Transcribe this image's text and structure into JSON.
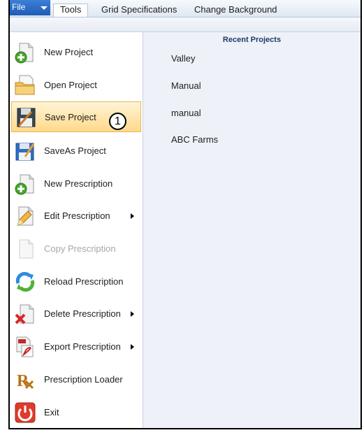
{
  "menubar": {
    "file_label": "File",
    "tabs": [
      {
        "label": "Tools",
        "active": true
      },
      {
        "label": "Grid Specifications",
        "active": false
      },
      {
        "label": "Change Background",
        "active": false
      }
    ]
  },
  "menu": {
    "items": [
      {
        "label": "New Project",
        "icon": "new-project-icon"
      },
      {
        "label": "Open Project",
        "icon": "open-folder-icon"
      },
      {
        "label": "Save Project",
        "icon": "save-icon",
        "highlighted": true
      },
      {
        "label": "SaveAs Project",
        "icon": "save-as-icon"
      },
      {
        "label": "New Prescription",
        "icon": "new-prescription-icon"
      },
      {
        "label": "Edit Prescription",
        "icon": "edit-prescription-icon",
        "submenu": true
      },
      {
        "label": "Copy Prescription",
        "icon": "copy-prescription-icon",
        "disabled": true
      },
      {
        "label": "Reload Prescription",
        "icon": "reload-icon"
      },
      {
        "label": "Delete Prescription",
        "icon": "delete-prescription-icon",
        "submenu": true
      },
      {
        "label": "Export Prescription",
        "icon": "export-pdf-icon",
        "submenu": true
      },
      {
        "label": "Prescription Loader",
        "icon": "rx-icon"
      },
      {
        "label": "Exit",
        "icon": "power-icon"
      }
    ]
  },
  "callout": {
    "number": "1"
  },
  "recent_projects": {
    "title": "Recent Projects",
    "items": [
      "Valley",
      "Manual",
      "manual",
      "ABC Farms"
    ]
  },
  "colors": {
    "accent": "#2a68c4",
    "highlight": "#ffd98a",
    "panel": "#eef2f8"
  }
}
